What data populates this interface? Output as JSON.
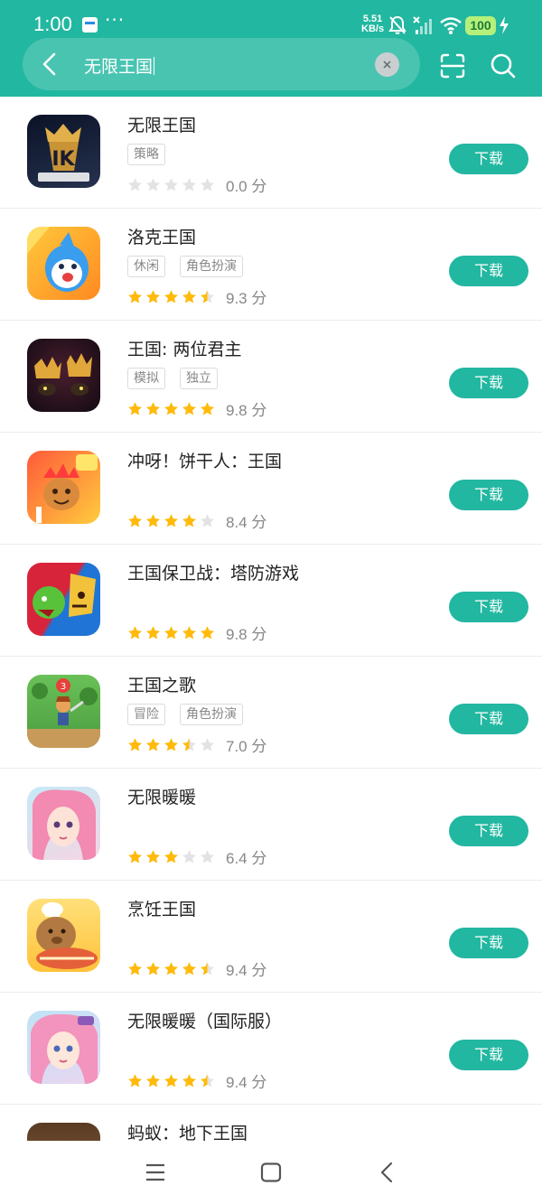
{
  "status": {
    "time": "1:00",
    "dots": "···",
    "speed_value": "5.51",
    "speed_unit": "KB/s",
    "battery": "100"
  },
  "search": {
    "query": "无限王国"
  },
  "colors": {
    "accent": "#22b7a0",
    "star_on": "#ffba0a",
    "star_off": "#e3e3e3"
  },
  "apps": [
    {
      "name": "无限王国",
      "tags": [
        "策略"
      ],
      "rating": 0,
      "score": "0.0 分",
      "button": "下载"
    },
    {
      "name": "洛克王国",
      "tags": [
        "休闲",
        "角色扮演"
      ],
      "rating": 4.5,
      "score": "9.3 分",
      "button": "下载"
    },
    {
      "name": "王国: 两位君主",
      "tags": [
        "模拟",
        "独立"
      ],
      "rating": 5,
      "score": "9.8 分",
      "button": "下载"
    },
    {
      "name": "冲呀！饼干人：王国",
      "tags": [],
      "rating": 4,
      "score": "8.4 分",
      "button": "下载"
    },
    {
      "name": "王国保卫战：塔防游戏",
      "tags": [],
      "rating": 5,
      "score": "9.8 分",
      "button": "下载"
    },
    {
      "name": "王国之歌",
      "tags": [
        "冒险",
        "角色扮演"
      ],
      "rating": 3.5,
      "score": "7.0 分",
      "button": "下载"
    },
    {
      "name": "无限暖暖",
      "tags": [],
      "rating": 3,
      "score": "6.4 分",
      "button": "下载"
    },
    {
      "name": "烹饪王国",
      "tags": [],
      "rating": 4.5,
      "score": "9.4 分",
      "button": "下载"
    },
    {
      "name": "无限暖暖（国际服）",
      "tags": [],
      "rating": 4.5,
      "score": "9.4 分",
      "button": "下载"
    },
    {
      "name": "蚂蚁：地下王国",
      "tags": [],
      "rating": 0,
      "score": "",
      "button": ""
    }
  ]
}
